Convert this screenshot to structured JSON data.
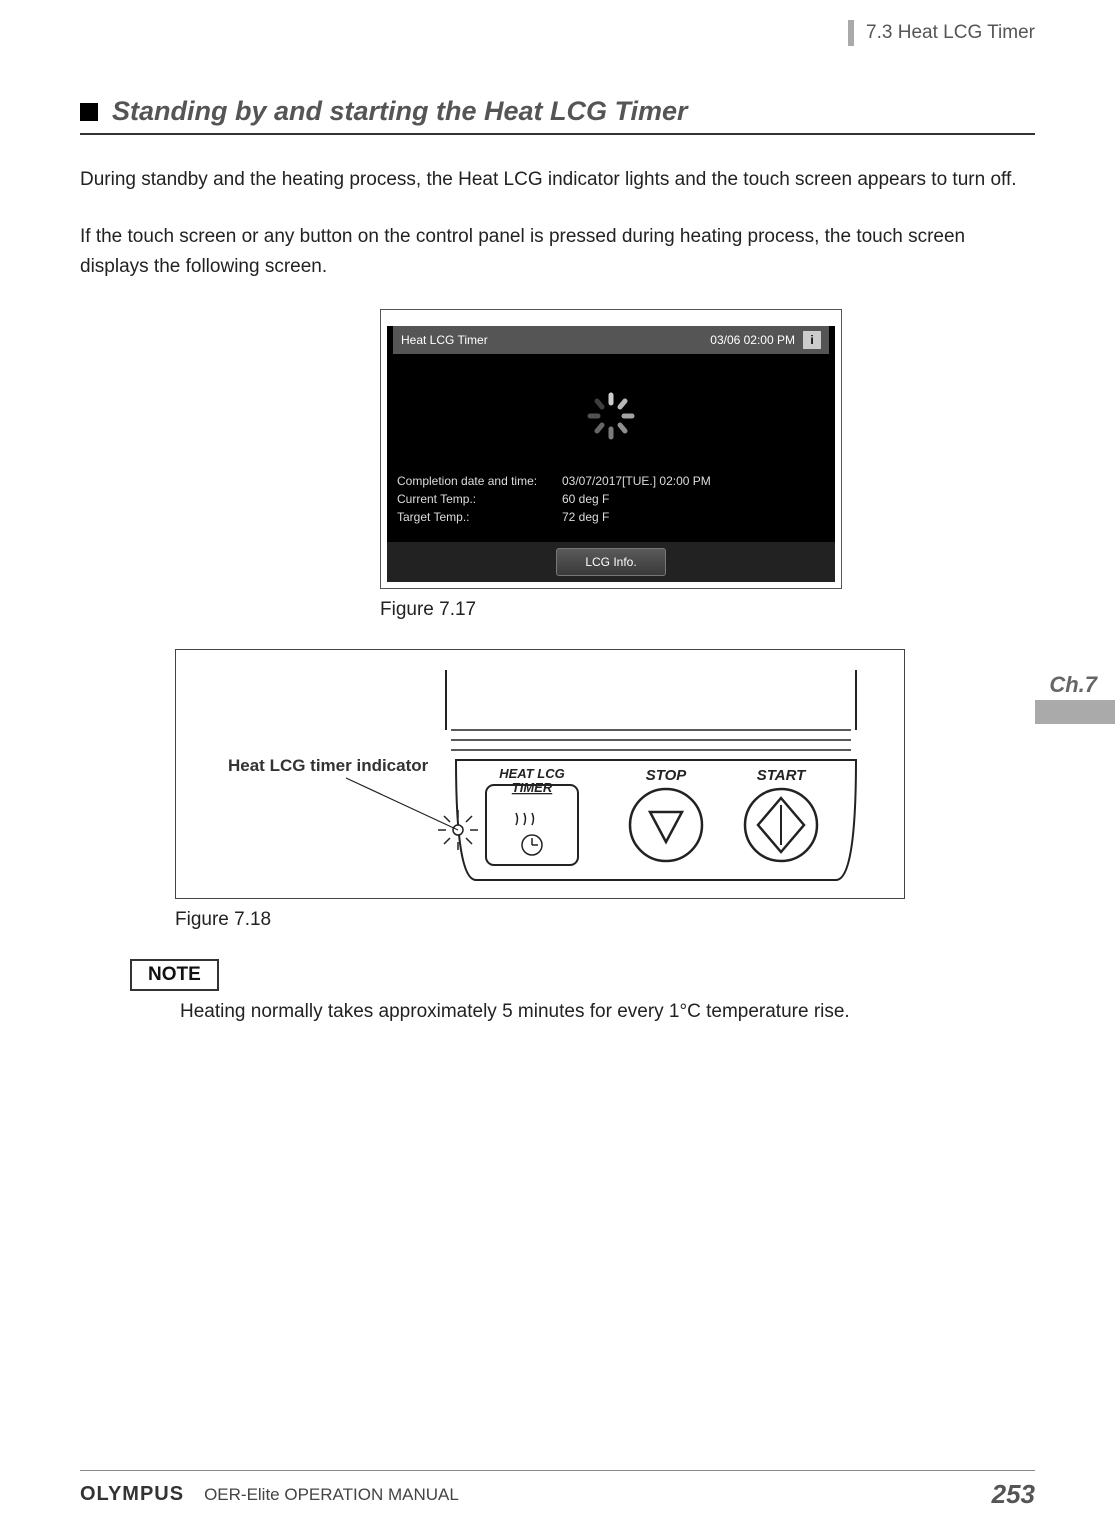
{
  "header": {
    "section": "7.3 Heat LCG Timer"
  },
  "heading": "Standing by and starting the Heat LCG Timer",
  "para1": "During standby and the heating process, the Heat LCG indicator lights and the touch screen appears to turn off.",
  "para2": "If the touch screen or any button on the control panel is pressed during heating process, the touch screen displays the following screen.",
  "touchscreen": {
    "title": "Heat LCG Timer",
    "datetime": "03/06 02:00 PM",
    "info_icon": "i",
    "rows": {
      "completion": {
        "label": "Completion date and time:",
        "value": "03/07/2017[TUE.] 02:00 PM"
      },
      "current": {
        "label": "Current Temp.:",
        "value": "60 deg F"
      },
      "target": {
        "label": "Target Temp.:",
        "value": "72 deg F"
      }
    },
    "button": "LCG Info."
  },
  "fig717_caption": "Figure  7.17",
  "control_panel": {
    "callout": "Heat LCG timer indicator",
    "btn_timer_top": "HEAT LCG",
    "btn_timer_bottom": "TIMER",
    "btn_stop": "STOP",
    "btn_start": "START"
  },
  "fig718_caption": "Figure  7.18",
  "note": {
    "label": "NOTE",
    "text": "Heating normally takes approximately 5 minutes for every 1°C temperature rise."
  },
  "chapter_tab": "Ch.7",
  "footer": {
    "brand": "OLYMPUS",
    "title": "OER-Elite OPERATION MANUAL",
    "page": "253"
  }
}
